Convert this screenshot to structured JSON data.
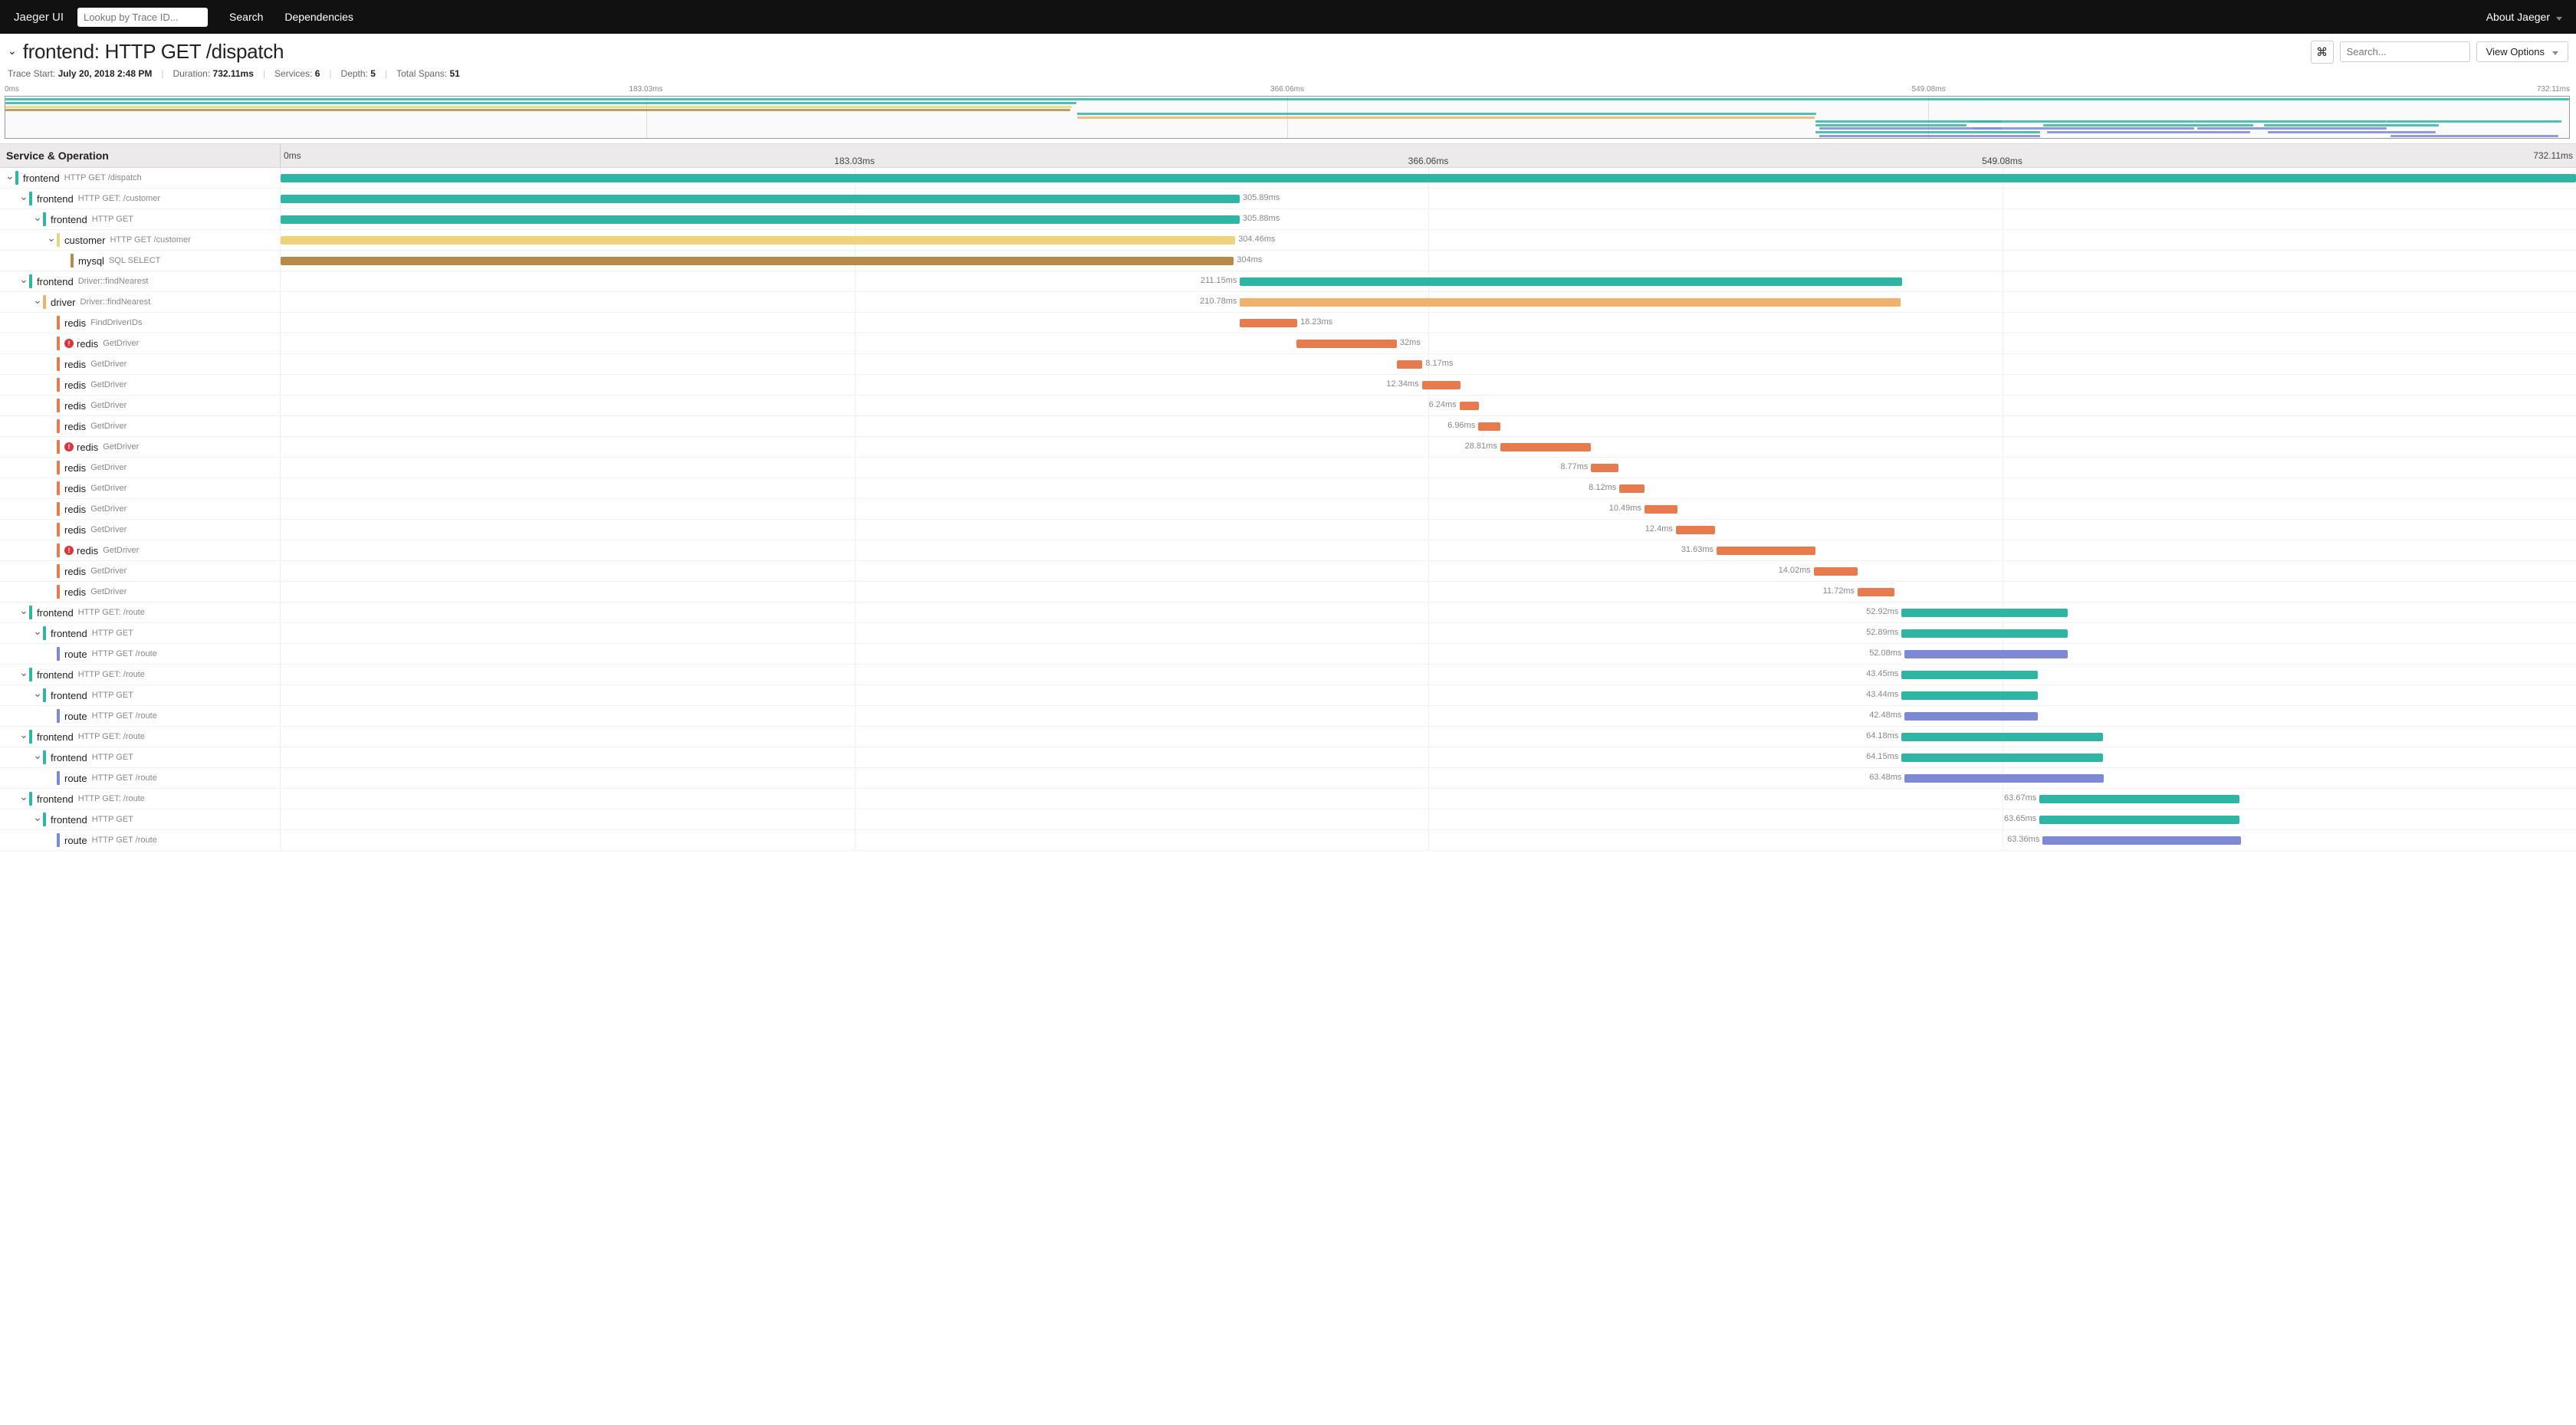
{
  "nav": {
    "brand": "Jaeger UI",
    "lookup_placeholder": "Lookup by Trace ID...",
    "links": [
      "Search",
      "Dependencies"
    ],
    "about": "About Jaeger"
  },
  "header": {
    "title_service": "frontend:",
    "title_op": "HTTP GET /dispatch",
    "search_placeholder": "Search...",
    "view_options": "View Options"
  },
  "meta": {
    "trace_start_label": "Trace Start:",
    "trace_start_value": "July 20, 2018 2:48 PM",
    "duration_label": "Duration:",
    "duration_value": "732.11ms",
    "services_label": "Services:",
    "services_value": "6",
    "depth_label": "Depth:",
    "depth_value": "5",
    "total_spans_label": "Total Spans:",
    "total_spans_value": "51"
  },
  "timeline": {
    "total_ms": 732.11,
    "ticks": [
      "0ms",
      "183.03ms",
      "366.06ms",
      "549.08ms",
      "732.11ms"
    ],
    "col_header": "Service & Operation"
  },
  "colors": {
    "frontend": "#2eb5a4",
    "customer": "#edd37e",
    "mysql": "#b58a4b",
    "driver": "#f0b26a",
    "redis": "#e87b4e",
    "route": "#7e89d6"
  },
  "chart_data": {
    "type": "gantt",
    "unit": "ms",
    "x_range": [
      0,
      732.11
    ],
    "ticks": [
      0,
      183.03,
      366.06,
      549.08,
      732.11
    ],
    "spans": [
      {
        "depth": 0,
        "expand": true,
        "service": "frontend",
        "op": "HTTP GET /dispatch",
        "color": "frontend",
        "start": 0,
        "dur": 732.11,
        "label": "",
        "err": false
      },
      {
        "depth": 1,
        "expand": true,
        "service": "frontend",
        "op": "HTTP GET: /customer",
        "color": "frontend",
        "start": 0,
        "dur": 305.89,
        "label": "305.89ms",
        "err": false
      },
      {
        "depth": 2,
        "expand": true,
        "service": "frontend",
        "op": "HTTP GET",
        "color": "frontend",
        "start": 0,
        "dur": 305.88,
        "label": "305.88ms",
        "err": false
      },
      {
        "depth": 3,
        "expand": true,
        "service": "customer",
        "op": "HTTP GET /customer",
        "color": "customer",
        "start": 0,
        "dur": 304.46,
        "label": "304.46ms",
        "err": false
      },
      {
        "depth": 4,
        "expand": false,
        "service": "mysql",
        "op": "SQL SELECT",
        "color": "mysql",
        "start": 0,
        "dur": 304,
        "label": "304ms",
        "err": false
      },
      {
        "depth": 1,
        "expand": true,
        "service": "frontend",
        "op": "Driver::findNearest",
        "color": "frontend",
        "start": 306,
        "dur": 211.15,
        "label": "211.15ms",
        "err": false,
        "label_side": "left"
      },
      {
        "depth": 2,
        "expand": true,
        "service": "driver",
        "op": "Driver::findNearest",
        "color": "driver",
        "start": 306,
        "dur": 210.78,
        "label": "210.78ms",
        "err": false,
        "label_side": "left"
      },
      {
        "depth": 3,
        "expand": false,
        "service": "redis",
        "op": "FindDriverIDs",
        "color": "redis",
        "start": 306,
        "dur": 18.23,
        "label": "18.23ms",
        "err": false
      },
      {
        "depth": 3,
        "expand": false,
        "service": "redis",
        "op": "GetDriver",
        "color": "redis",
        "start": 324,
        "dur": 32,
        "label": "32ms",
        "err": true
      },
      {
        "depth": 3,
        "expand": false,
        "service": "redis",
        "op": "GetDriver",
        "color": "redis",
        "start": 356,
        "dur": 8.17,
        "label": "8.17ms",
        "err": false
      },
      {
        "depth": 3,
        "expand": false,
        "service": "redis",
        "op": "GetDriver",
        "color": "redis",
        "start": 364,
        "dur": 12.34,
        "label": "12.34ms",
        "err": false,
        "label_side": "left"
      },
      {
        "depth": 3,
        "expand": false,
        "service": "redis",
        "op": "GetDriver",
        "color": "redis",
        "start": 376,
        "dur": 6.24,
        "label": "6.24ms",
        "err": false,
        "label_side": "left"
      },
      {
        "depth": 3,
        "expand": false,
        "service": "redis",
        "op": "GetDriver",
        "color": "redis",
        "start": 382,
        "dur": 6.96,
        "label": "6.96ms",
        "err": false,
        "label_side": "left"
      },
      {
        "depth": 3,
        "expand": false,
        "service": "redis",
        "op": "GetDriver",
        "color": "redis",
        "start": 389,
        "dur": 28.81,
        "label": "28.81ms",
        "err": true,
        "label_side": "left"
      },
      {
        "depth": 3,
        "expand": false,
        "service": "redis",
        "op": "GetDriver",
        "color": "redis",
        "start": 418,
        "dur": 8.77,
        "label": "8.77ms",
        "err": false,
        "label_side": "left"
      },
      {
        "depth": 3,
        "expand": false,
        "service": "redis",
        "op": "GetDriver",
        "color": "redis",
        "start": 427,
        "dur": 8.12,
        "label": "8.12ms",
        "err": false,
        "label_side": "left"
      },
      {
        "depth": 3,
        "expand": false,
        "service": "redis",
        "op": "GetDriver",
        "color": "redis",
        "start": 435,
        "dur": 10.49,
        "label": "10.49ms",
        "err": false,
        "label_side": "left"
      },
      {
        "depth": 3,
        "expand": false,
        "service": "redis",
        "op": "GetDriver",
        "color": "redis",
        "start": 445,
        "dur": 12.4,
        "label": "12.4ms",
        "err": false,
        "label_side": "left"
      },
      {
        "depth": 3,
        "expand": false,
        "service": "redis",
        "op": "GetDriver",
        "color": "redis",
        "start": 458,
        "dur": 31.63,
        "label": "31.63ms",
        "err": true,
        "label_side": "left"
      },
      {
        "depth": 3,
        "expand": false,
        "service": "redis",
        "op": "GetDriver",
        "color": "redis",
        "start": 489,
        "dur": 14.02,
        "label": "14.02ms",
        "err": false,
        "label_side": "left"
      },
      {
        "depth": 3,
        "expand": false,
        "service": "redis",
        "op": "GetDriver",
        "color": "redis",
        "start": 503,
        "dur": 11.72,
        "label": "11.72ms",
        "err": false,
        "label_side": "left"
      },
      {
        "depth": 1,
        "expand": true,
        "service": "frontend",
        "op": "HTTP GET: /route",
        "color": "frontend",
        "start": 517,
        "dur": 52.92,
        "label": "52.92ms",
        "err": false,
        "label_side": "left"
      },
      {
        "depth": 2,
        "expand": true,
        "service": "frontend",
        "op": "HTTP GET",
        "color": "frontend",
        "start": 517,
        "dur": 52.89,
        "label": "52.89ms",
        "err": false,
        "label_side": "left"
      },
      {
        "depth": 3,
        "expand": false,
        "service": "route",
        "op": "HTTP GET /route",
        "color": "route",
        "start": 518,
        "dur": 52.08,
        "label": "52.08ms",
        "err": false,
        "label_side": "left"
      },
      {
        "depth": 1,
        "expand": true,
        "service": "frontend",
        "op": "HTTP GET: /route",
        "color": "frontend",
        "start": 517,
        "dur": 43.45,
        "label": "43.45ms",
        "err": false,
        "label_side": "left"
      },
      {
        "depth": 2,
        "expand": true,
        "service": "frontend",
        "op": "HTTP GET",
        "color": "frontend",
        "start": 517,
        "dur": 43.44,
        "label": "43.44ms",
        "err": false,
        "label_side": "left"
      },
      {
        "depth": 3,
        "expand": false,
        "service": "route",
        "op": "HTTP GET /route",
        "color": "route",
        "start": 518,
        "dur": 42.48,
        "label": "42.48ms",
        "err": false,
        "label_side": "left"
      },
      {
        "depth": 1,
        "expand": true,
        "service": "frontend",
        "op": "HTTP GET: /route",
        "color": "frontend",
        "start": 517,
        "dur": 64.18,
        "label": "64.18ms",
        "err": false,
        "label_side": "left"
      },
      {
        "depth": 2,
        "expand": true,
        "service": "frontend",
        "op": "HTTP GET",
        "color": "frontend",
        "start": 517,
        "dur": 64.15,
        "label": "64.15ms",
        "err": false,
        "label_side": "left"
      },
      {
        "depth": 3,
        "expand": false,
        "service": "route",
        "op": "HTTP GET /route",
        "color": "route",
        "start": 518,
        "dur": 63.48,
        "label": "63.48ms",
        "err": false,
        "label_side": "left"
      },
      {
        "depth": 1,
        "expand": true,
        "service": "frontend",
        "op": "HTTP GET: /route",
        "color": "frontend",
        "start": 561,
        "dur": 63.67,
        "label": "63.67ms",
        "err": false,
        "label_side": "left"
      },
      {
        "depth": 2,
        "expand": true,
        "service": "frontend",
        "op": "HTTP GET",
        "color": "frontend",
        "start": 561,
        "dur": 63.65,
        "label": "63.65ms",
        "err": false,
        "label_side": "left"
      },
      {
        "depth": 3,
        "expand": false,
        "service": "route",
        "op": "HTTP GET /route",
        "color": "route",
        "start": 562,
        "dur": 63.36,
        "label": "63.36ms",
        "err": false,
        "label_side": "left"
      }
    ]
  },
  "minimap_bars": [
    {
      "color": "frontend",
      "start": 0,
      "dur": 732.11,
      "row": 0
    },
    {
      "color": "frontend",
      "start": 0,
      "dur": 305.89,
      "row": 1
    },
    {
      "color": "customer",
      "start": 0,
      "dur": 304.46,
      "row": 2
    },
    {
      "color": "mysql",
      "start": 0,
      "dur": 304,
      "row": 3
    },
    {
      "color": "frontend",
      "start": 306,
      "dur": 211.15,
      "row": 4
    },
    {
      "color": "driver",
      "start": 306,
      "dur": 210.78,
      "row": 5
    },
    {
      "color": "frontend",
      "start": 517,
      "dur": 53,
      "row": 6
    },
    {
      "color": "frontend",
      "start": 517,
      "dur": 43,
      "row": 7
    },
    {
      "color": "route",
      "start": 518,
      "dur": 52,
      "row": 8
    },
    {
      "color": "frontend",
      "start": 517,
      "dur": 64,
      "row": 9
    },
    {
      "color": "route",
      "start": 518,
      "dur": 63,
      "row": 10
    },
    {
      "color": "frontend",
      "start": 561,
      "dur": 64,
      "row": 6
    },
    {
      "color": "route",
      "start": 562,
      "dur": 63,
      "row": 8
    },
    {
      "color": "frontend",
      "start": 582,
      "dur": 60,
      "row": 7
    },
    {
      "color": "route",
      "start": 583,
      "dur": 58,
      "row": 9
    },
    {
      "color": "frontend",
      "start": 625,
      "dur": 55,
      "row": 6
    },
    {
      "color": "route",
      "start": 626,
      "dur": 54,
      "row": 8
    },
    {
      "color": "frontend",
      "start": 645,
      "dur": 50,
      "row": 7
    },
    {
      "color": "route",
      "start": 646,
      "dur": 48,
      "row": 9
    },
    {
      "color": "frontend",
      "start": 680,
      "dur": 50,
      "row": 6
    },
    {
      "color": "route",
      "start": 681,
      "dur": 48,
      "row": 10
    }
  ]
}
